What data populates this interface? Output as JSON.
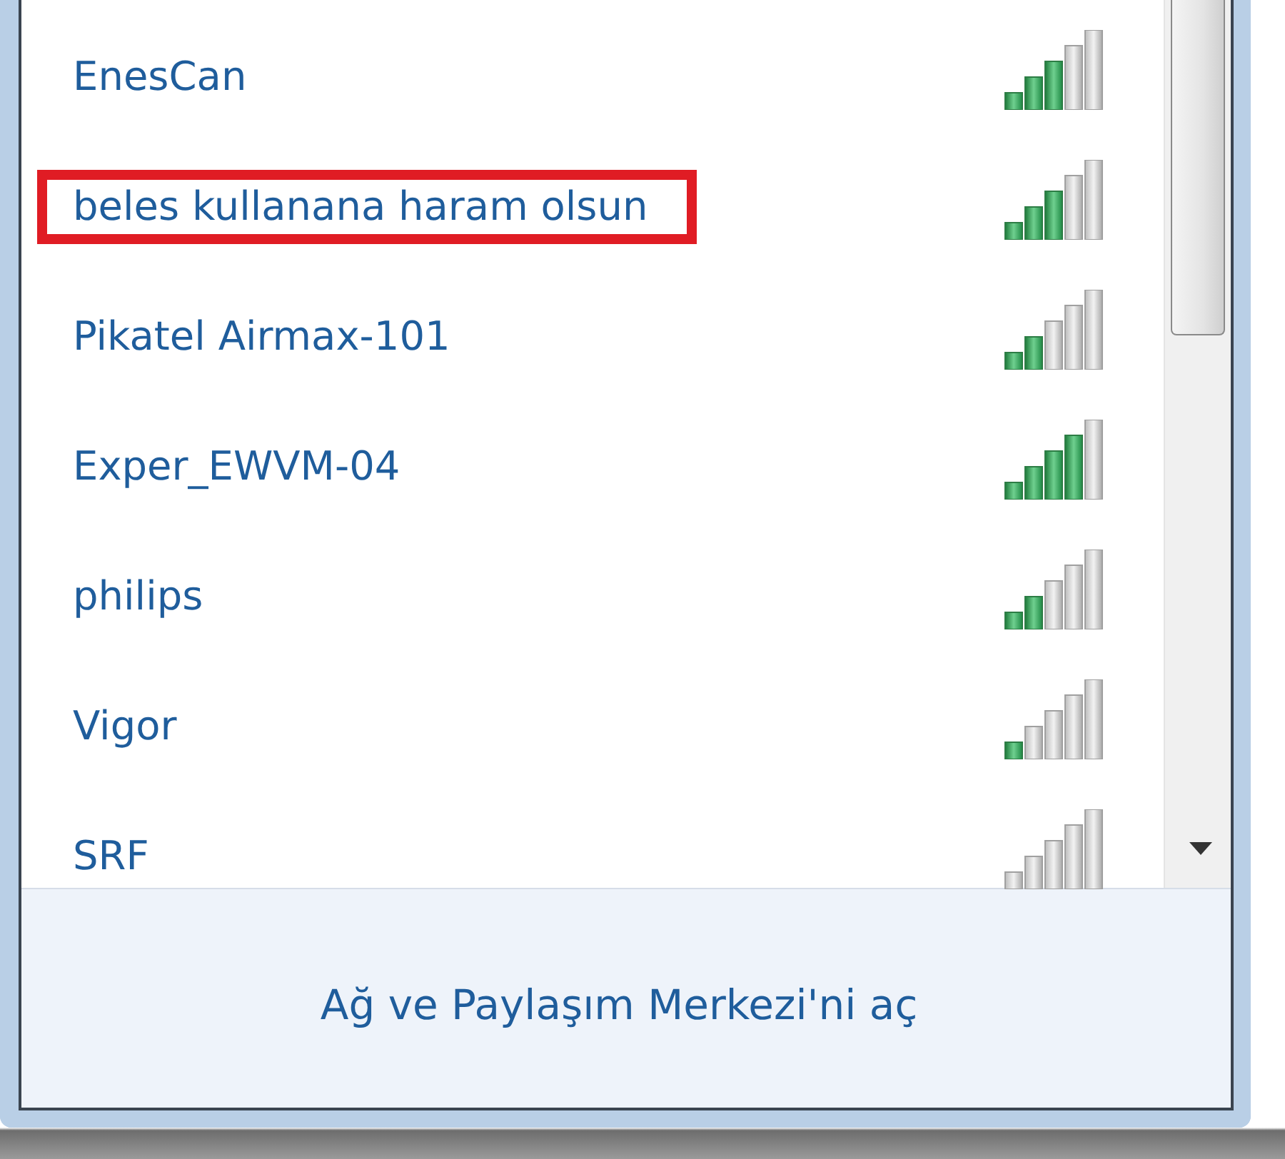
{
  "networks": [
    {
      "name": "EnesCan",
      "kind": "three-bars",
      "highlighted": false
    },
    {
      "name": "beles kullanana haram olsun",
      "kind": "three-bars",
      "highlighted": true
    },
    {
      "name": "Pikatel Airmax-101",
      "kind": "two-bars",
      "highlighted": false
    },
    {
      "name": "Exper_EWVM-04",
      "kind": "four-bars",
      "highlighted": false
    },
    {
      "name": "philips",
      "kind": "two-bars",
      "highlighted": false
    },
    {
      "name": "Vigor",
      "kind": "one-bar",
      "highlighted": false
    },
    {
      "name": "SRF",
      "kind": "no-bars",
      "highlighted": false
    }
  ],
  "footer": {
    "link": "Ağ ve Paylaşım Merkezi'ni aç"
  }
}
